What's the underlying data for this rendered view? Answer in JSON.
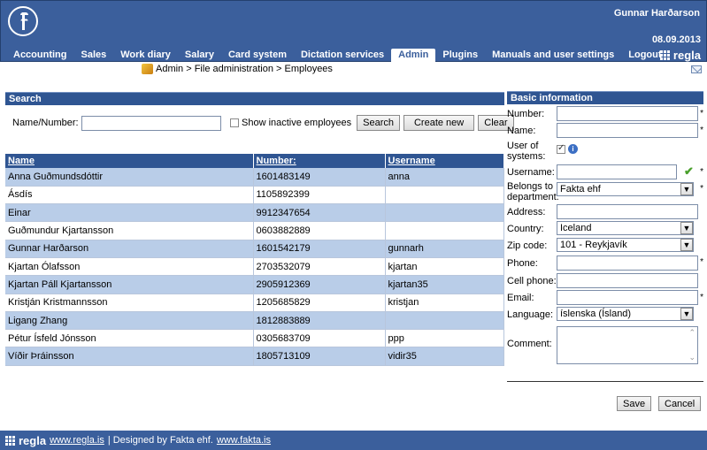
{
  "header": {
    "user": "Gunnar Harðarson",
    "date": "08.09.2013",
    "brand": "regla"
  },
  "nav": [
    "Accounting",
    "Sales",
    "Work diary",
    "Salary",
    "Card system",
    "Dictation services",
    "Admin",
    "Plugins",
    "Manuals and user settings",
    "Logout"
  ],
  "breadcrumb": "Admin > File administration > Employees",
  "search": {
    "title": "Search",
    "label": "Name/Number:",
    "value": "",
    "inactive_label": "Show inactive employees",
    "search_btn": "Search",
    "create_btn": "Create new",
    "clear_btn": "Clear"
  },
  "table": {
    "headers": [
      "Name",
      "Number:",
      "Username"
    ],
    "rows": [
      [
        "Anna Guðmundsdóttir",
        "1601483149",
        "anna"
      ],
      [
        "Ásdís",
        "1105892399",
        ""
      ],
      [
        "Einar",
        "9912347654",
        ""
      ],
      [
        "Guðmundur Kjartansson",
        "0603882889",
        ""
      ],
      [
        "Gunnar Harðarson",
        "1601542179",
        "gunnarh"
      ],
      [
        "Kjartan Ólafsson",
        "2703532079",
        "kjartan"
      ],
      [
        "Kjartan Páll Kjartansson",
        "2905912369",
        "kjartan35"
      ],
      [
        "Kristján Kristmannsson",
        "1205685829",
        "kristjan"
      ],
      [
        "Ligang Zhang",
        "1812883889",
        ""
      ],
      [
        "Pétur Ísfeld Jónsson",
        "0305683709",
        "ppp"
      ],
      [
        "Víðir Þráinsson",
        "1805713109",
        "vidir35"
      ]
    ]
  },
  "form": {
    "title": "Basic information",
    "number_label": "Number:",
    "name_label": "Name:",
    "user_label": "User of systems:",
    "username_label": "Username:",
    "dept_label": "Belongs to department:",
    "dept_value": "Fakta ehf",
    "address_label": "Address:",
    "country_label": "Country:",
    "country_value": "Iceland",
    "zip_label": "Zip code:",
    "zip_value": "101 - Reykjavík",
    "phone_label": "Phone:",
    "cell_label": "Cell phone:",
    "email_label": "Email:",
    "lang_label": "Language:",
    "lang_value": "íslenska (Ísland)",
    "comment_label": "Comment:",
    "save_btn": "Save",
    "cancel_btn": "Cancel",
    "required": "*"
  },
  "footer": {
    "brand": "regla",
    "link1": "www.regla.is",
    "mid": "| Designed by Fakta ehf.",
    "link2": "www.fakta.is"
  }
}
